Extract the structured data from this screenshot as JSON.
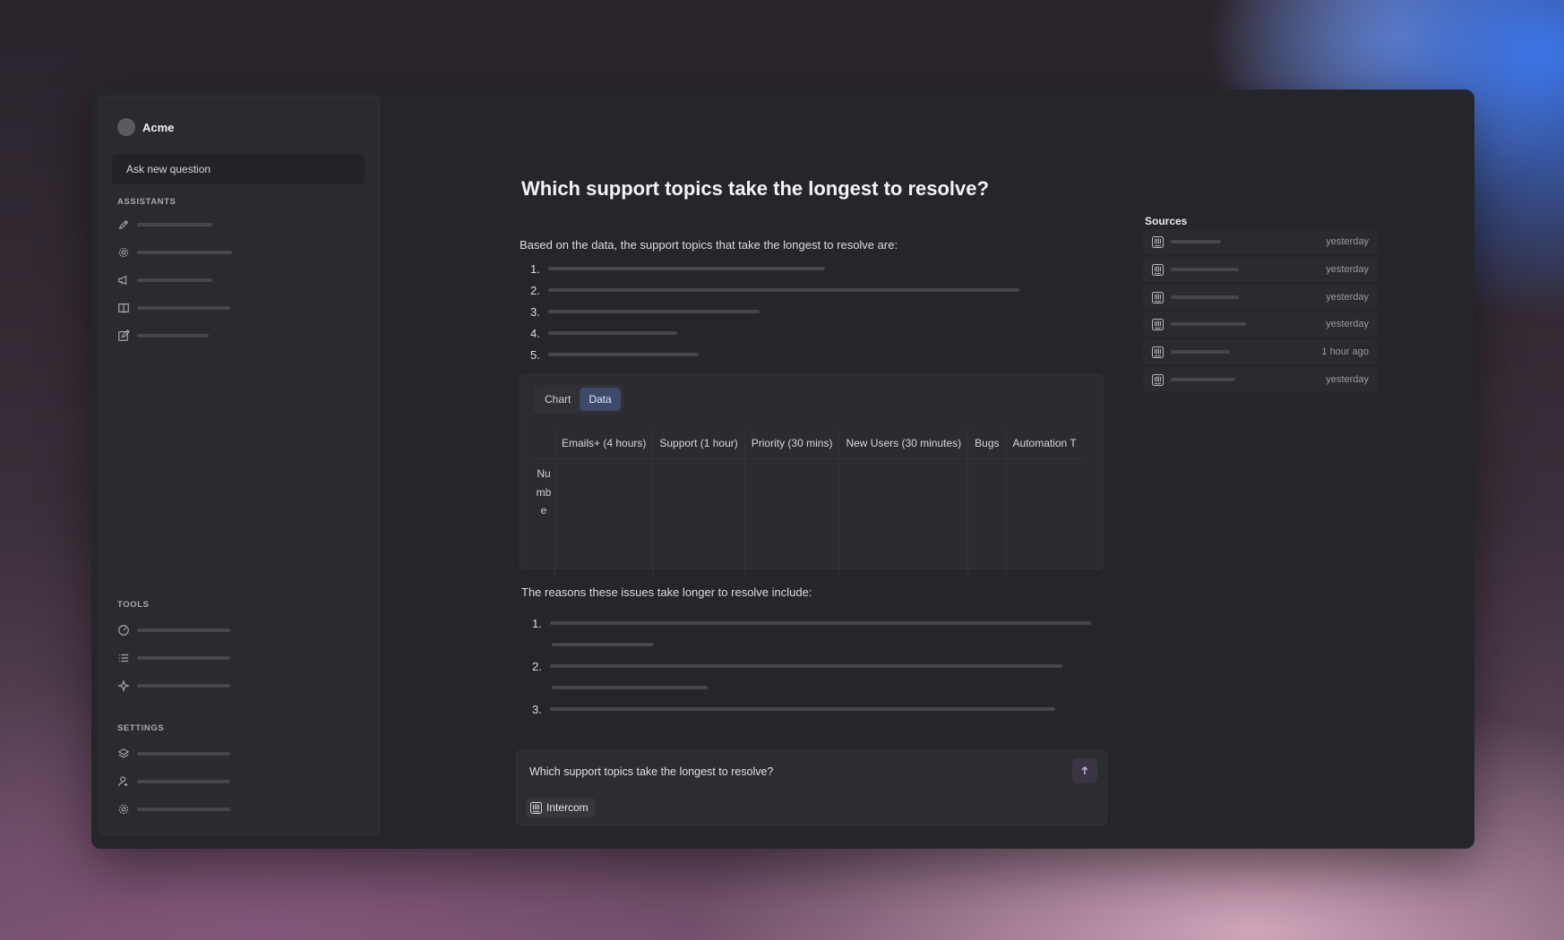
{
  "app": {
    "name": "Acme",
    "ask_button": "Ask new question"
  },
  "sidebar": {
    "assistants_header": "ASSISTANTS",
    "assistants": [
      {
        "icon": "pen-icon"
      },
      {
        "icon": "gear-icon"
      },
      {
        "icon": "megaphone-icon"
      },
      {
        "icon": "book-icon"
      },
      {
        "icon": "edit-square-icon"
      }
    ],
    "tools_header": "TOOLS",
    "tools": [
      {
        "icon": "gauge-icon"
      },
      {
        "icon": "list-icon"
      },
      {
        "icon": "sparkle-icon"
      }
    ],
    "settings_header": "SETTINGS",
    "settings": [
      {
        "icon": "layers-icon"
      },
      {
        "icon": "user-plus-icon"
      },
      {
        "icon": "gear-icon"
      }
    ]
  },
  "answer": {
    "question": "Which support topics take the longest to resolve?",
    "intro": "Based on the data, the support topics that take the longest to resolve are:",
    "list_numbers": [
      "1.",
      "2.",
      "3.",
      "4.",
      "5."
    ],
    "tabs": {
      "chart": "Chart",
      "data": "Data",
      "active": "Data"
    },
    "table": {
      "columns": [
        "Emails+ (4 hours)",
        "Support (1 hour)",
        "Priority (30 mins)",
        "New Users (30 minutes)",
        "Bugs",
        "Automation T"
      ],
      "row_label": "Numbe"
    },
    "reasons_intro": "The reasons these issues take longer to resolve include:",
    "reasons_numbers": [
      "1.",
      "2.",
      "3."
    ]
  },
  "composer": {
    "text": "Which support topics take the longest to resolve?",
    "chip_label": "Intercom"
  },
  "sources": {
    "title": "Sources",
    "items": [
      {
        "time": "yesterday"
      },
      {
        "time": "yesterday"
      },
      {
        "time": "yesterday"
      },
      {
        "time": "yesterday"
      },
      {
        "time": "1 hour ago"
      },
      {
        "time": "yesterday"
      }
    ]
  },
  "colors": {
    "window_bg": "#25262a",
    "active_tab": "#3d4a6a",
    "send_button": "#3b3443"
  }
}
